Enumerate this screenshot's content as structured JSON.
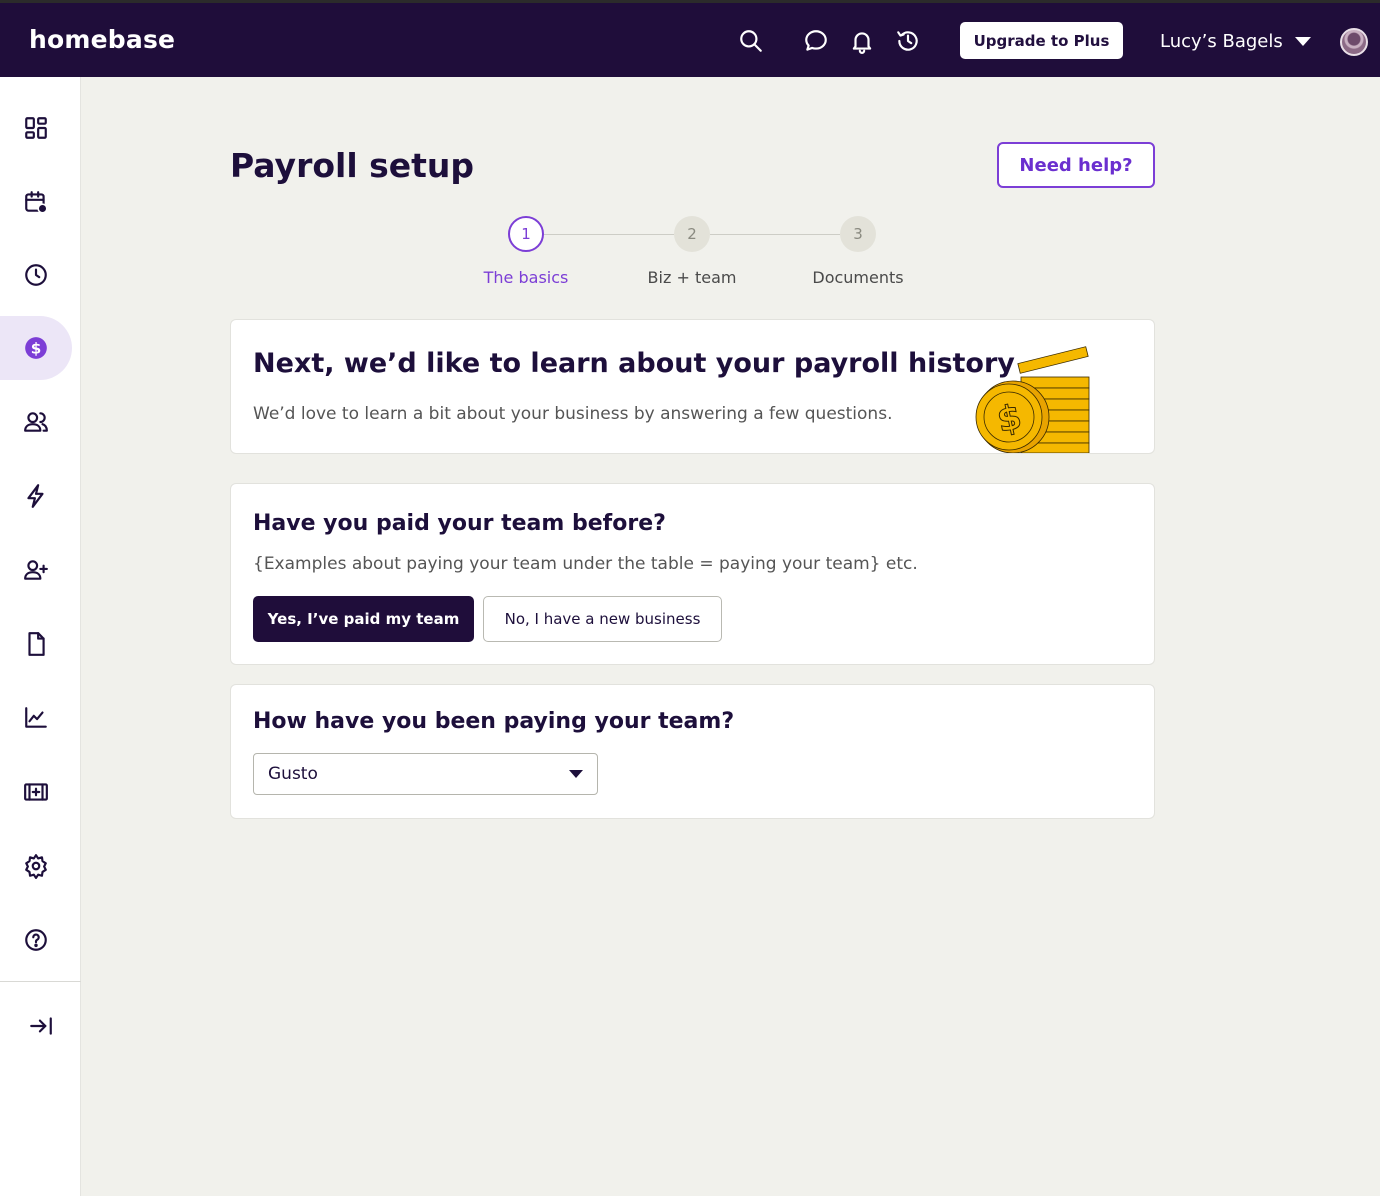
{
  "header": {
    "logo": "homebase",
    "upgrade_label": "Upgrade to Plus",
    "account_name": "Lucy’s Bagels",
    "icons": [
      "search-icon",
      "chat-icon",
      "bell-icon",
      "history-icon"
    ]
  },
  "sidebar": {
    "items": [
      {
        "icon": "dashboard-icon"
      },
      {
        "icon": "schedule-icon"
      },
      {
        "icon": "clock-icon"
      },
      {
        "icon": "payroll-icon",
        "active": true
      },
      {
        "icon": "team-icon"
      },
      {
        "icon": "lightning-icon"
      },
      {
        "icon": "add-user-icon"
      },
      {
        "icon": "document-icon"
      },
      {
        "icon": "reports-icon"
      },
      {
        "icon": "add-ons-icon"
      },
      {
        "icon": "settings-icon"
      },
      {
        "icon": "help-icon"
      }
    ],
    "collapse_icon": "collapse-sidebar-icon"
  },
  "page": {
    "title": "Payroll setup",
    "help_label": "Need help?"
  },
  "stepper": {
    "steps": [
      {
        "number": "1",
        "label": "The basics",
        "active": true
      },
      {
        "number": "2",
        "label": "Biz + team",
        "active": false
      },
      {
        "number": "3",
        "label": "Documents",
        "active": false
      }
    ]
  },
  "intro_card": {
    "title": "Next, we’d like to learn about your payroll history",
    "subtitle": "We’d love to learn a bit about your business by answering a few questions."
  },
  "paid_card": {
    "title": "Have you paid your team before?",
    "subtitle": "{Examples about paying your team under the table = paying your team} etc.",
    "yes_label": "Yes, I’ve paid my team",
    "no_label": "No, I have a new business"
  },
  "method_card": {
    "title": "How have you been paying your team?",
    "selected": "Gusto"
  },
  "colors": {
    "nav_bg": "#1f0d3a",
    "accent": "#7c3ed6",
    "coin": "#f5b800"
  }
}
